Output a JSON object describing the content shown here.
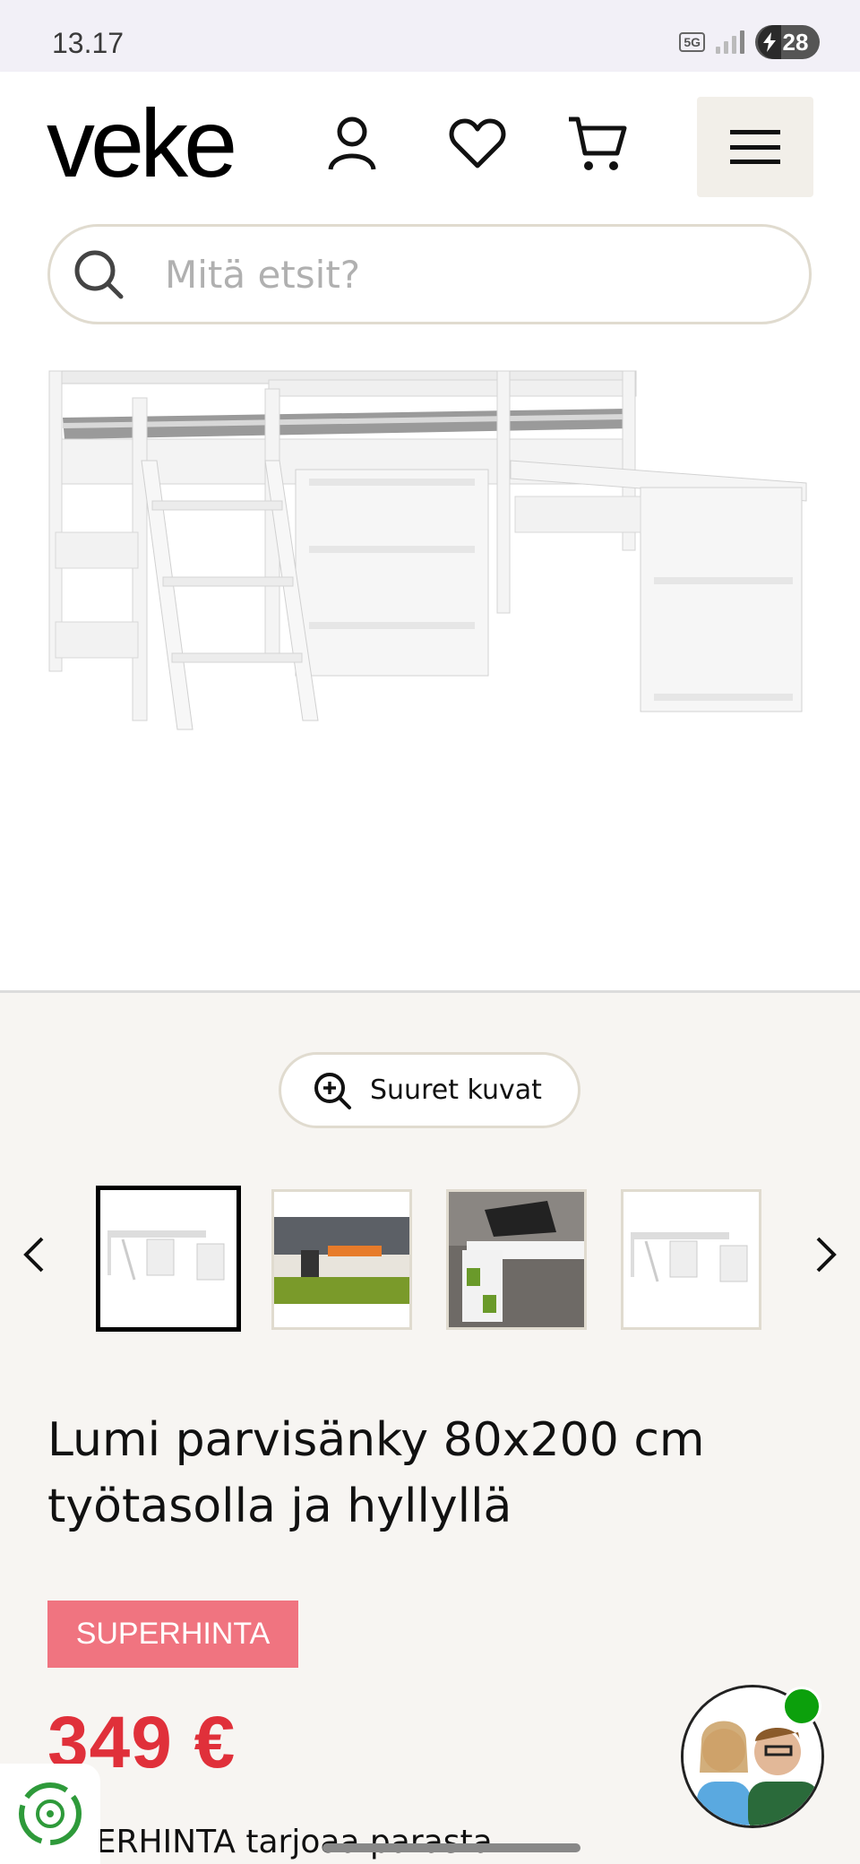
{
  "status_bar": {
    "time": "13.17",
    "network": "5G",
    "battery": "28"
  },
  "header": {
    "logo": "veke",
    "search": {
      "placeholder": "Mitä etsit?"
    }
  },
  "gallery": {
    "zoom_label": "Suuret kuvat",
    "active_thumbnail": 1,
    "thumbnail_count": 4
  },
  "product": {
    "title": "Lumi parvisänky 80x200 cm työtasolla ja hyllyllä",
    "badge": "SUPERHINTA",
    "price": "349 €",
    "description": "PERHINTA tarjoaa parasta"
  },
  "colors": {
    "price": "#e0303a",
    "badge_bg": "#f07480",
    "page_bg": "#f7f5f2",
    "online": "#0ca00c"
  }
}
